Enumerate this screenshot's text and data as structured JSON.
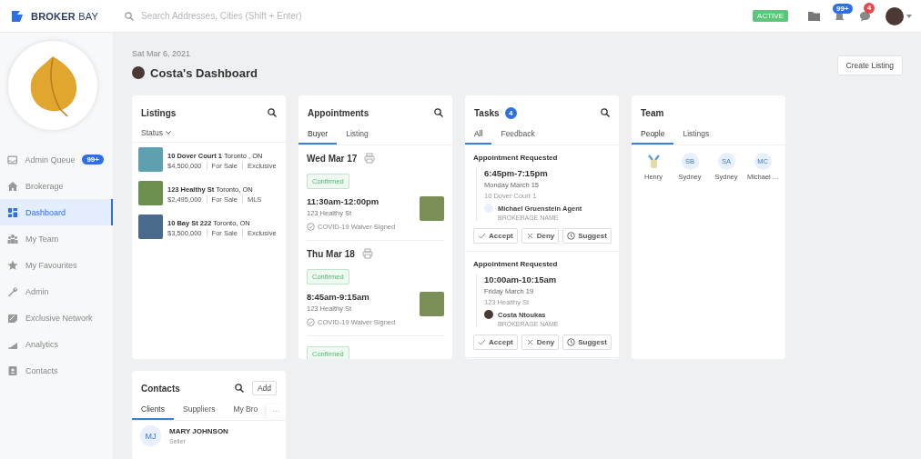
{
  "topbar": {
    "logo_1": "BROKER",
    "logo_2": "BAY",
    "search": {
      "placeholder": "Search Addresses, Cities (Shift + Enter)"
    },
    "status": "ACTIVE",
    "notifications_badge": "99+",
    "messages_badge": "4"
  },
  "sidebar": {
    "items": [
      {
        "label": "Admin Queue",
        "badge": "99+",
        "selected": false
      },
      {
        "label": "Brokerage",
        "selected": false
      },
      {
        "label": "Dashboard",
        "selected": true
      },
      {
        "label": "My Team",
        "selected": false
      },
      {
        "label": "My Favourites",
        "selected": false
      },
      {
        "label": "Admin",
        "selected": false
      },
      {
        "label": "Exclusive Network",
        "selected": false
      },
      {
        "label": "Analytics",
        "selected": false
      },
      {
        "label": "Contacts",
        "selected": false
      }
    ]
  },
  "header": {
    "date": "Sat Mar 6, 2021",
    "title": "Costa's Dashboard",
    "create_button": "Create Listing"
  },
  "listings": {
    "title": "Listings",
    "filter": "Status",
    "items": [
      {
        "address": "10 Dover Court 1",
        "city": "Toronto , ON",
        "price": "$4,500,000",
        "status": "For Sale",
        "type": "Exclusive"
      },
      {
        "address": "123 Healthy St",
        "city": "Toronto, ON",
        "price": "$2,495,000",
        "status": "For Sale",
        "type": "MLS"
      },
      {
        "address": "10 Bay St 222",
        "city": "Toronto, ON",
        "price": "$3,500,000",
        "status": "For Sale",
        "type": "Exclusive"
      }
    ]
  },
  "appointments": {
    "title": "Appointments",
    "tabs": [
      {
        "label": "Buyer",
        "selected": true
      },
      {
        "label": "Listing",
        "selected": false
      }
    ],
    "days": [
      {
        "date": "Wed Mar 17",
        "entries": [
          {
            "badge": "Confirmed",
            "time": "11:30am-12:00pm",
            "address": "123 Healthy St",
            "waiver": "COVID-19 Waiver Signed"
          }
        ]
      },
      {
        "date": "Thu Mar 18",
        "entries": [
          {
            "badge": "Confirmed",
            "time": "8:45am-9:15am",
            "address": "123 Healthy St",
            "waiver": "COVID-19 Waiver Signed"
          }
        ]
      },
      {
        "entries": [
          {
            "badge": "Confirmed"
          }
        ]
      }
    ]
  },
  "tasks": {
    "title": "Tasks",
    "count": "4",
    "tabs": [
      {
        "label": "All",
        "selected": true
      },
      {
        "label": "Feedback",
        "selected": false
      }
    ],
    "items": [
      {
        "heading": "Appointment Requested",
        "time": "6:45pm-7:15pm",
        "date": "Monday March 15",
        "address": "10 Dover Court 1",
        "agent": "Michael Gruenstein Agent",
        "kind": "initials",
        "brokerage": "BROKERAGE NAME",
        "actions": [
          "Accept",
          "Deny",
          "Suggest"
        ]
      },
      {
        "heading": "Appointment Requested",
        "time": "10:00am-10:15am",
        "date": "Friday March 19",
        "address": "123 Healthy St",
        "agent": "Costa Ntoukas",
        "kind": "photo",
        "brokerage": "BROKERAGE NAME",
        "actions": [
          "Accept",
          "Deny",
          "Suggest"
        ]
      }
    ]
  },
  "team": {
    "title": "Team",
    "tabs": [
      {
        "label": "People",
        "selected": true
      },
      {
        "label": "Listings",
        "selected": false
      }
    ],
    "people": [
      {
        "name": "Henry",
        "kind": "picture"
      },
      {
        "name": "Sydney",
        "kind": "initials",
        "initials": "SB"
      },
      {
        "name": "Sydney",
        "kind": "initials",
        "initials": "SA"
      },
      {
        "name": "Michael ...",
        "kind": "initials",
        "initials": "MC"
      }
    ]
  },
  "contacts": {
    "title": "Contacts",
    "add_button": "Add",
    "tabs": [
      {
        "label": "Clients",
        "selected": true
      },
      {
        "label": "Suppliers",
        "selected": false
      },
      {
        "label": "My Bro",
        "selected": false
      }
    ],
    "more": "···",
    "items": [
      {
        "initials": "MJ",
        "name": "MARY JOHNSON",
        "role": "Seller"
      }
    ]
  }
}
